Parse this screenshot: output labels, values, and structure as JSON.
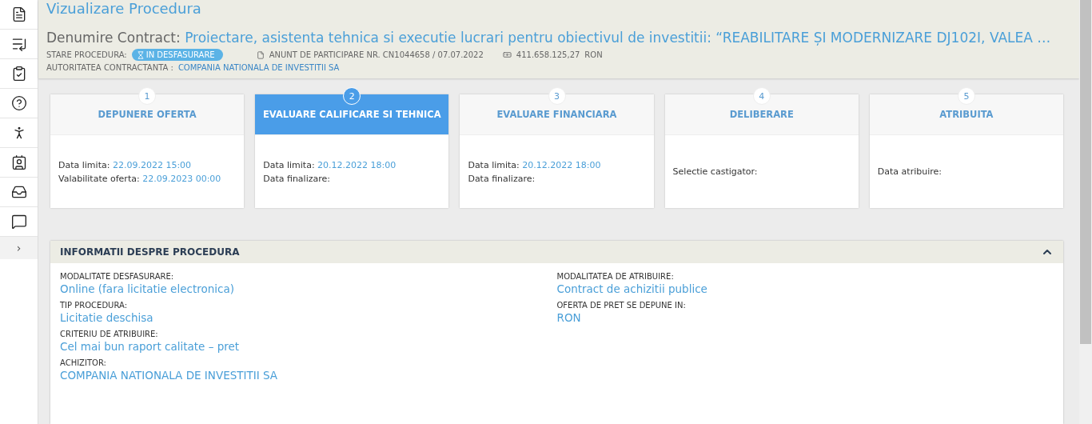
{
  "sidebar": {
    "expand": "›"
  },
  "header": {
    "title": "Vizualizare Procedura",
    "contract_label": "Denumire Contract:",
    "contract_name": "Proiectare, asistenta tehnica si executie lucrari pentru obiectivul de investitii: “REABILITARE ȘI MODERNIZARE DJ102I, VALEA …",
    "status_label": "STARE PROCEDURA:",
    "status": "IN DESFASURARE",
    "notice": "ANUNT DE PARTICIPARE NR. CN1044658 / 07.07.2022",
    "amount": "411.658.125,27",
    "currency": "RON",
    "authority_label": "AUTORITATEA CONTRACTANTA :",
    "authority": "COMPANIA NATIONALA DE INVESTITII SA"
  },
  "steps": [
    {
      "number": "1",
      "title": "DEPUNERE OFERTA",
      "selected": false,
      "lines": [
        {
          "label": "Data limita:",
          "value": "22.09.2022 15:00"
        },
        {
          "label": "Valabilitate oferta:",
          "value": "22.09.2023 00:00"
        }
      ]
    },
    {
      "number": "2",
      "title": "EVALUARE CALIFICARE SI TEHNICA",
      "selected": true,
      "lines": [
        {
          "label": "Data limita:",
          "value": "20.12.2022 18:00"
        },
        {
          "label": "Data finalizare:"
        }
      ]
    },
    {
      "number": "3",
      "title": "EVALUARE FINANCIARA",
      "selected": false,
      "lines": [
        {
          "label": "Data limita:",
          "value": "20.12.2022 18:00"
        },
        {
          "label": "Data finalizare:"
        }
      ]
    },
    {
      "number": "4",
      "title": "DELIBERARE",
      "selected": false,
      "lines": [
        {
          "label": "Selectie castigator:"
        }
      ]
    },
    {
      "number": "5",
      "title": "ATRIBUITA",
      "selected": false,
      "lines": [
        {
          "label": "Data atribuire:"
        }
      ]
    }
  ],
  "info_panel": {
    "title": "INFORMATII DESPRE PROCEDURA",
    "expanded": true,
    "columns": [
      [
        {
          "label": "MODALITATE DESFASURARE:",
          "value": "Online (fara licitatie electronica)"
        },
        {
          "label": "TIP PROCEDURA:",
          "value": "Licitatie deschisa"
        },
        {
          "label": "CRITERIU DE ATRIBUIRE:",
          "value": "Cel mai bun raport calitate – pret"
        },
        {
          "label": "ACHIZITOR:",
          "value": "COMPANIA NATIONALA DE INVESTITII SA"
        }
      ],
      [
        {
          "label": "MODALITATEA DE ATRIBUIRE:",
          "value": "Contract de achizitii publice"
        },
        {
          "label": "OFERTA DE PRET SE DEPUNE IN:",
          "value": "RON"
        }
      ]
    ]
  }
}
